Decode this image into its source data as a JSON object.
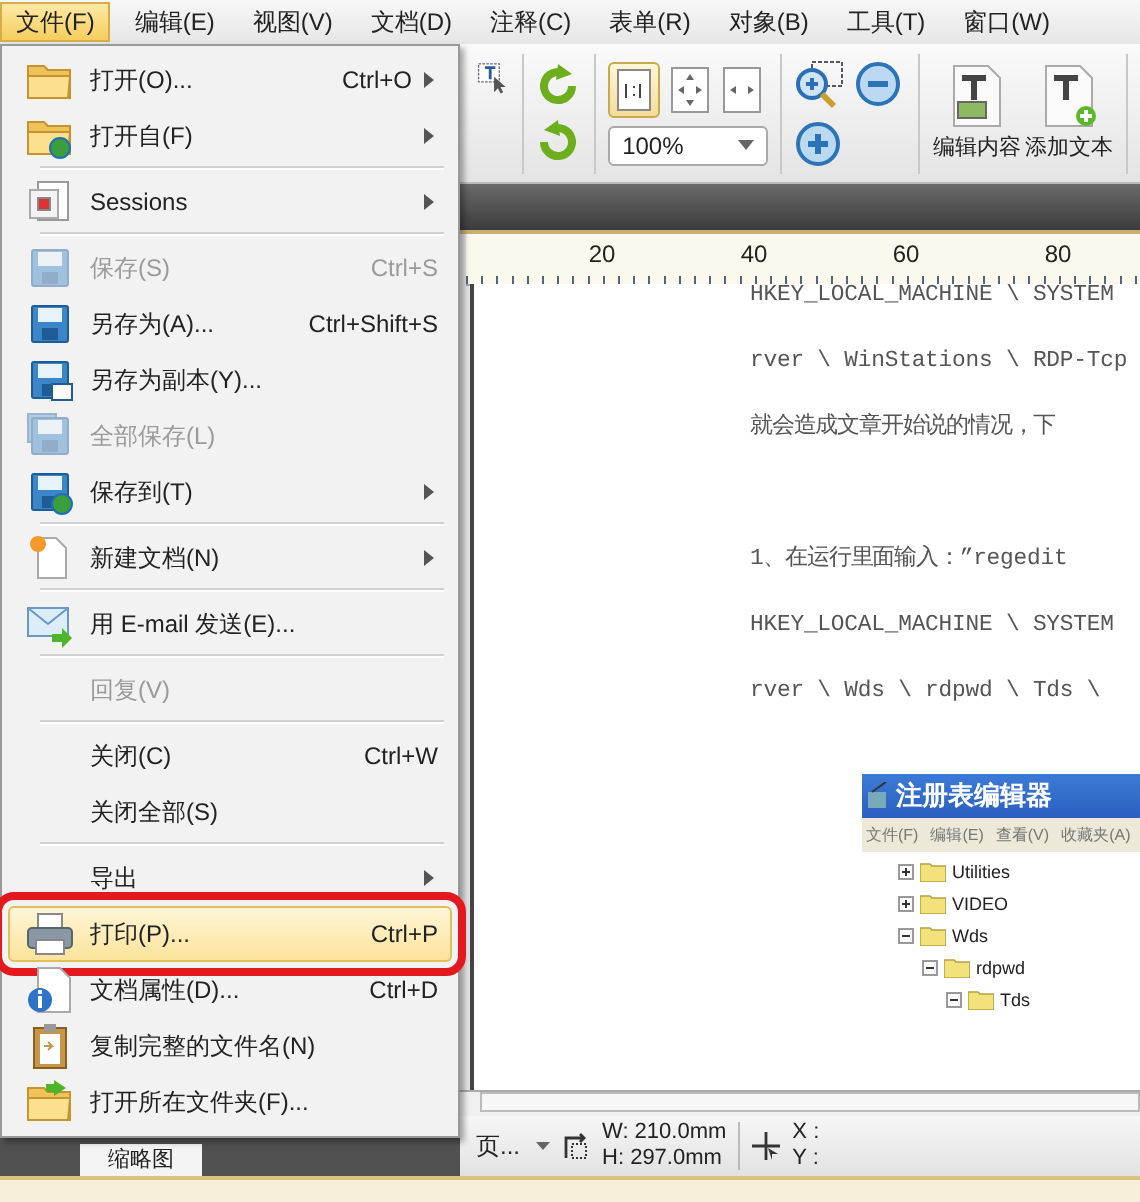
{
  "menu_bar": [
    {
      "label": "文件(F)",
      "selected": true
    },
    {
      "label": "编辑(E)",
      "selected": false
    },
    {
      "label": "视图(V)",
      "selected": false
    },
    {
      "label": "文档(D)",
      "selected": false
    },
    {
      "label": "注释(C)",
      "selected": false
    },
    {
      "label": "表单(R)",
      "selected": false
    },
    {
      "label": "对象(B)",
      "selected": false
    },
    {
      "label": "工具(T)",
      "selected": false
    },
    {
      "label": "窗口(W)",
      "selected": false
    }
  ],
  "toolbar": {
    "zoom_combo": {
      "value": "100%"
    },
    "actual_size_selected": true,
    "buttons": [
      {
        "label": "编辑内容"
      },
      {
        "label": "添加文本"
      }
    ]
  },
  "ruler": {
    "ticks": [
      "20",
      "40",
      "60",
      "80"
    ]
  },
  "document": {
    "paragraphs": [
      {
        "lines": [
          "HKEY_LOCAL_MACHINE \\ SYSTEM",
          "rver \\ WinStations \\ RDP-Tcp",
          "就会造成文章开始说的情况，下"
        ]
      },
      {
        "lines": [
          "1、在运行里面输入：”regedit",
          "HKEY_LOCAL_MACHINE \\ SYSTEM",
          "rver \\ Wds \\ rdpwd \\ Tds \\"
        ]
      }
    ],
    "embedded_window": {
      "title": "注册表编辑器",
      "menu": [
        "文件(F)",
        "编辑(E)",
        "查看(V)",
        "收藏夹(A)"
      ],
      "tree": [
        {
          "label": "Utilities",
          "expanded": false
        },
        {
          "label": "VIDEO",
          "expanded": false
        },
        {
          "label": "Wds",
          "expanded": true,
          "children": [
            {
              "label": "rdpwd",
              "expanded": true,
              "children": [
                {
                  "label": "Tds",
                  "expanded": true
                }
              ]
            }
          ]
        }
      ]
    }
  },
  "file_menu": {
    "items": [
      {
        "kind": "item",
        "label": "打开(O)...",
        "shortcut": "Ctrl+O",
        "submenu": true,
        "disabled": false,
        "selected": false,
        "annotated": false
      },
      {
        "kind": "item",
        "label": "打开自(F)",
        "submenu": true,
        "disabled": false,
        "selected": false,
        "annotated": false
      },
      {
        "kind": "separator"
      },
      {
        "kind": "item",
        "label": "Sessions",
        "submenu": true,
        "disabled": false,
        "selected": false,
        "annotated": false
      },
      {
        "kind": "separator"
      },
      {
        "kind": "item",
        "label": "保存(S)",
        "shortcut": "Ctrl+S",
        "submenu": false,
        "disabled": true,
        "selected": false,
        "annotated": false
      },
      {
        "kind": "item",
        "label": "另存为(A)...",
        "shortcut": "Ctrl+Shift+S",
        "submenu": false,
        "disabled": false,
        "selected": false,
        "annotated": false
      },
      {
        "kind": "item",
        "label": "另存为副本(Y)...",
        "submenu": false,
        "disabled": false,
        "selected": false,
        "annotated": false
      },
      {
        "kind": "item",
        "label": "全部保存(L)",
        "submenu": false,
        "disabled": true,
        "selected": false,
        "annotated": false
      },
      {
        "kind": "item",
        "label": "保存到(T)",
        "submenu": true,
        "disabled": false,
        "selected": false,
        "annotated": false
      },
      {
        "kind": "separator"
      },
      {
        "kind": "item",
        "label": "新建文档(N)",
        "submenu": true,
        "disabled": false,
        "selected": false,
        "annotated": false
      },
      {
        "kind": "separator"
      },
      {
        "kind": "item",
        "label": "用 E-mail 发送(E)...",
        "submenu": false,
        "disabled": false,
        "selected": false,
        "annotated": false
      },
      {
        "kind": "separator"
      },
      {
        "kind": "item",
        "label": "回复(V)",
        "submenu": false,
        "disabled": true,
        "selected": false,
        "annotated": false
      },
      {
        "kind": "separator"
      },
      {
        "kind": "item",
        "label": "关闭(C)",
        "shortcut": "Ctrl+W",
        "submenu": false,
        "disabled": false,
        "selected": false,
        "annotated": false
      },
      {
        "kind": "item",
        "label": "关闭全部(S)",
        "submenu": false,
        "disabled": false,
        "selected": false,
        "annotated": false
      },
      {
        "kind": "separator"
      },
      {
        "kind": "item",
        "label": "导出",
        "submenu": true,
        "disabled": false,
        "selected": false,
        "annotated": false
      },
      {
        "kind": "item",
        "label": "打印(P)...",
        "shortcut": "Ctrl+P",
        "submenu": false,
        "disabled": false,
        "selected": true,
        "annotated": true
      },
      {
        "kind": "item",
        "label": "文档属性(D)...",
        "shortcut": "Ctrl+D",
        "submenu": false,
        "disabled": false,
        "selected": false,
        "annotated": false
      },
      {
        "kind": "item",
        "label": "复制完整的文件名(N)",
        "submenu": false,
        "disabled": false,
        "selected": false,
        "annotated": false
      },
      {
        "kind": "item",
        "label": "打开所在文件夹(F)...",
        "submenu": false,
        "disabled": false,
        "selected": false,
        "annotated": false
      }
    ]
  },
  "left_panel": {
    "tabs": [
      {
        "label": "缩略图",
        "selected": true
      }
    ]
  },
  "status_bar": {
    "page_combo": "页...",
    "width": "W: 210.0mm",
    "height": "H: 297.0mm",
    "x": "X :",
    "y": "Y :"
  }
}
